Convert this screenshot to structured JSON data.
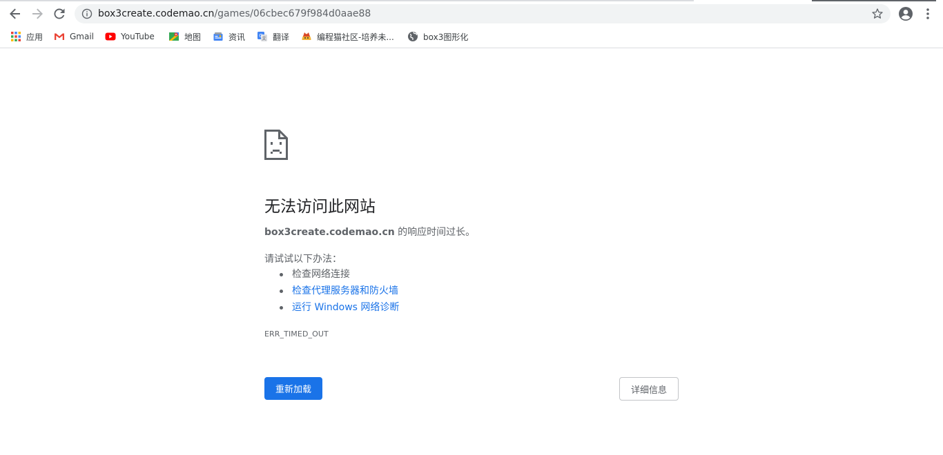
{
  "toolbar": {
    "back_icon": "arrow-left-icon",
    "forward_icon": "arrow-right-icon",
    "reload_icon": "reload-icon",
    "url_host": "box3create.codemao.cn",
    "url_path": "/games/06cbec679f984d0aae88",
    "info_icon": "info-icon",
    "star_icon": "star-icon",
    "account_icon": "account-icon",
    "menu_icon": "kebab-menu-icon"
  },
  "bookmarks": [
    {
      "label": "应用",
      "icon": "apps-grid-icon"
    },
    {
      "label": "Gmail",
      "icon": "gmail-icon"
    },
    {
      "label": "YouTube",
      "icon": "youtube-icon"
    },
    {
      "label": "地图",
      "icon": "maps-icon"
    },
    {
      "label": "资讯",
      "icon": "news-icon"
    },
    {
      "label": "翻译",
      "icon": "translate-icon"
    },
    {
      "label": "编程猫社区-培养未...",
      "icon": "codemao-icon"
    },
    {
      "label": "box3图形化",
      "icon": "globe-icon"
    }
  ],
  "error": {
    "icon": "sad-page-icon",
    "heading": "无法访问此网站",
    "host": "box3create.codemao.cn",
    "description_suffix": " 的响应时间过长。",
    "try_label": "请试试以下办法：",
    "suggestions": [
      {
        "text": "检查网络连接",
        "link": false
      },
      {
        "text": "检查代理服务器和防火墙",
        "link": true
      },
      {
        "text": "运行 Windows 网络诊断",
        "link": true
      }
    ],
    "code": "ERR_TIMED_OUT",
    "reload_label": "重新加载",
    "details_label": "详细信息"
  },
  "colors": {
    "accent": "#1a73e8",
    "text_secondary": "#5f6368",
    "omnibox_bg": "#f1f3f4"
  }
}
